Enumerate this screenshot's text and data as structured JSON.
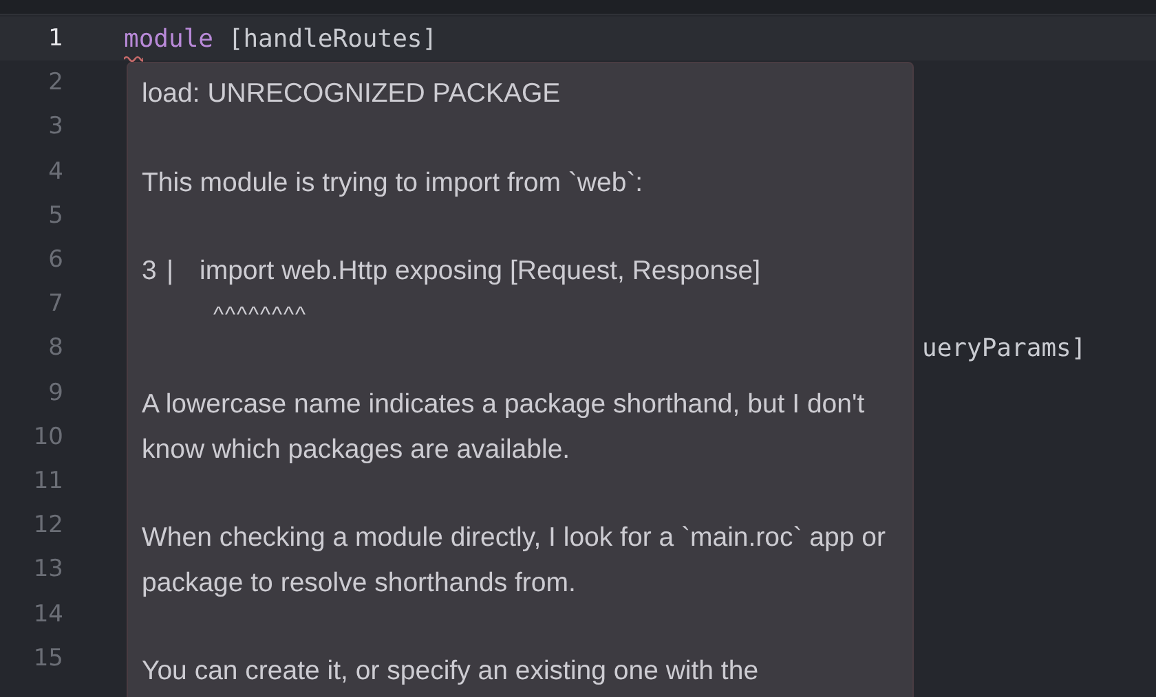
{
  "editor": {
    "lines": [
      {
        "number": "1",
        "current": true,
        "tokens": [
          {
            "kind": "keyword",
            "text": "module",
            "squiggle": true
          },
          {
            "kind": "plain",
            "text": " [handleRoutes]"
          }
        ]
      },
      {
        "number": "2",
        "current": false
      },
      {
        "number": "3",
        "current": false
      },
      {
        "number": "4",
        "current": false
      },
      {
        "number": "5",
        "current": false
      },
      {
        "number": "6",
        "current": false
      },
      {
        "number": "7",
        "current": false
      },
      {
        "number": "8",
        "current": false,
        "tokens": [
          {
            "kind": "hidden-tail",
            "text": "ueryParams]"
          }
        ]
      },
      {
        "number": "9",
        "current": false
      },
      {
        "number": "10",
        "current": false
      },
      {
        "number": "11",
        "current": false
      },
      {
        "number": "12",
        "current": false
      },
      {
        "number": "13",
        "current": false
      },
      {
        "number": "14",
        "current": false
      },
      {
        "number": "15",
        "current": false
      }
    ]
  },
  "diagnostic_popup": {
    "blocks": [
      {
        "kind": "text",
        "text": "load: UNRECOGNIZED PACKAGE"
      },
      {
        "kind": "text",
        "text": "This module is trying to import from `web`:"
      },
      {
        "kind": "code",
        "line_number": "3",
        "separator": "|",
        "code": "import web.Http exposing [Request, Response]",
        "carets": "^^^^^^^^"
      },
      {
        "kind": "text",
        "text": "A lowercase name indicates a package shorthand, but I don't know which packages are available."
      },
      {
        "kind": "text",
        "text": "When checking a module directly, I look for a `main.roc` app or package to resolve shorthands from."
      },
      {
        "kind": "text",
        "text": "You can create it, or specify an existing one with the"
      }
    ]
  }
}
